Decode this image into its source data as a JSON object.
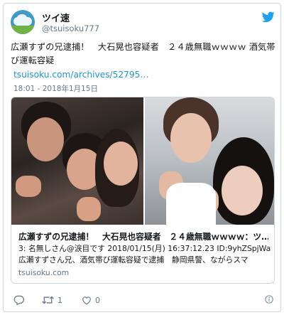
{
  "tweet": {
    "display_name": "ツイ速",
    "handle": "@tsuisoku777",
    "text": "広瀬すずの兄逮捕！　大石晃也容疑者　２４歳無職ｗｗｗｗ 酒気帯び運転容疑",
    "link": "tsuisoku.com/archives/52795…",
    "timestamp": "18:01 - 2018年1月15日"
  },
  "card": {
    "title": "広瀬すずの兄逮捕！　大石晃也容疑者　２４歳無職ｗｗｗｗ：ツ…",
    "desc_line1": "3: 名無しさん@涙目です 2018/01/15(月) 16:37:12.23 ID:9yhZSpjWa",
    "desc_line2": "広瀬すずさん兄、酒気帯び運転容疑で逮捕　静岡県警、ながらスマ",
    "domain": "tsuisoku.com"
  },
  "actions": {
    "reply_count": "",
    "retweet_count": "1",
    "like_count": "0"
  },
  "colors": {
    "link": "#1b95e0",
    "muted": "#657786",
    "twitter_blue": "#1da1f2"
  },
  "icons": [
    "twitter-bird-icon",
    "reply-icon",
    "retweet-icon",
    "like-heart-icon",
    "info-icon"
  ]
}
